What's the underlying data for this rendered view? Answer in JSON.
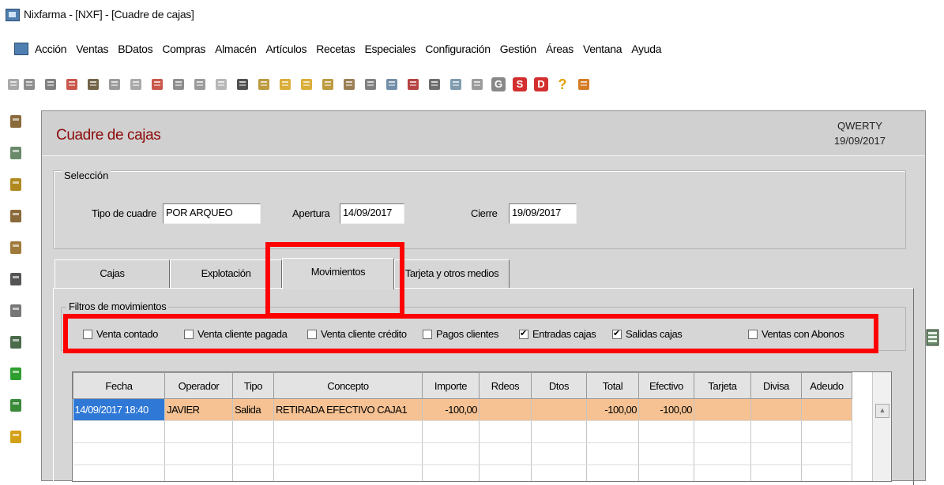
{
  "window": {
    "title": "Nixfarma - [NXF] - [Cuadre de cajas]"
  },
  "menu": [
    "Acción",
    "Ventas",
    "BDatos",
    "Compras",
    "Almacén",
    "Artículos",
    "Recetas",
    "Especiales",
    "Configuración",
    "Gestión",
    "Áreas",
    "Ventana",
    "Ayuda"
  ],
  "toolbar_icons": [
    {
      "name": "grip-icon",
      "color": "#9a9a9a"
    },
    {
      "name": "document-list-icon",
      "color": "#7a7a7a"
    },
    {
      "name": "edit-document-icon",
      "color": "#6a6a6a"
    },
    {
      "name": "stop-icon",
      "color": "#c0392b"
    },
    {
      "name": "print-report-icon",
      "color": "#5a4a2a"
    },
    {
      "name": "notes-icon",
      "color": "#8a8a8a"
    },
    {
      "name": "table-icon",
      "color": "#9a9a9a"
    },
    {
      "name": "pill-bottle-icon",
      "color": "#c0392b"
    },
    {
      "name": "list-icon",
      "color": "#7a7a7a"
    },
    {
      "name": "calculator-icon",
      "color": "#8a8a8a"
    },
    {
      "name": "star-outline-icon",
      "color": "#aaaaaa"
    },
    {
      "name": "star-icon",
      "color": "#333333"
    },
    {
      "name": "exit-icon",
      "color": "#b08a20"
    },
    {
      "name": "arrow-left-icon",
      "color": "#d4a017"
    },
    {
      "name": "arrow-right-icon",
      "color": "#d4a017"
    },
    {
      "name": "import-icon",
      "color": "#b08a20"
    },
    {
      "name": "printer-icon",
      "color": "#8a6a3a"
    },
    {
      "name": "search-icon",
      "color": "#6a6a6a"
    },
    {
      "name": "person-icon",
      "color": "#5a7a9a"
    },
    {
      "name": "lock-icon",
      "color": "#aa2222"
    },
    {
      "name": "block-icon",
      "color": "#555555"
    },
    {
      "name": "monitor-icon",
      "color": "#6a8aa0"
    },
    {
      "name": "filter-icon",
      "color": "#8a8a8a"
    },
    {
      "name": "g-icon",
      "color": "#888888",
      "text": "G"
    },
    {
      "name": "s-icon",
      "color": "#d32f2f",
      "text": "S"
    },
    {
      "name": "d-icon",
      "color": "#d32f2f",
      "text": "D"
    },
    {
      "name": "help-icon",
      "color": "#e0a000",
      "text": "?"
    },
    {
      "name": "home-icon",
      "color": "#cc6600"
    }
  ],
  "left_icons": [
    {
      "name": "cash-register-icon",
      "color": "#8a6a3a"
    },
    {
      "name": "euro-icon",
      "color": "#6a8a6a"
    },
    {
      "name": "customer-icon",
      "color": "#b08a20"
    },
    {
      "name": "cart-icon",
      "color": "#8a6a3a"
    },
    {
      "name": "card-icon",
      "color": "#a07a3a"
    },
    {
      "name": "pen-icon",
      "color": "#555555"
    },
    {
      "name": "money-icon",
      "color": "#777777"
    },
    {
      "name": "form-icon",
      "color": "#4a6a4a"
    },
    {
      "name": "plus-icon",
      "color": "#2e9e2e"
    },
    {
      "name": "refresh-icon",
      "color": "#3a8a3a"
    },
    {
      "name": "warning-icon",
      "color": "#d4a017"
    }
  ],
  "header": {
    "title": "Cuadre de cajas",
    "user": "QWERTY",
    "date": "19/09/2017"
  },
  "seleccion": {
    "label": "Selección",
    "tipo_label": "Tipo de cuadre",
    "tipo_value": "POR ARQUEO",
    "apertura_label": "Apertura",
    "apertura_value": "14/09/2017",
    "cierre_label": "Cierre",
    "cierre_value": "19/09/2017"
  },
  "tabs": [
    "Cajas",
    "Explotación",
    "Movimientos",
    "Tarjeta y otros medios"
  ],
  "active_tab": "Movimientos",
  "filtros": {
    "label": "Filtros de movimientos",
    "items": [
      {
        "label": "Venta contado",
        "checked": false
      },
      {
        "label": "Venta cliente pagada",
        "checked": false
      },
      {
        "label": "Venta cliente crédito",
        "checked": false
      },
      {
        "label": "Pagos clientes",
        "checked": false
      },
      {
        "label": "Entradas cajas",
        "checked": true
      },
      {
        "label": "Salidas cajas",
        "checked": true
      },
      {
        "label": "Ventas con Abonos",
        "checked": false
      }
    ]
  },
  "grid": {
    "columns": [
      "Fecha",
      "Operador",
      "Tipo",
      "Concepto",
      "Importe",
      "Rdeos",
      "Dtos",
      "Total",
      "Efectivo",
      "Tarjeta",
      "Divisa",
      "Adeudo"
    ],
    "rows": [
      [
        "14/09/2017 18:40",
        "JAVIER",
        "Salida",
        "RETIRADA EFECTIVO CAJA1",
        "-100,00",
        "",
        "",
        "-100,00",
        "-100,00",
        "",
        "",
        ""
      ]
    ]
  },
  "colors": {
    "title_red": "#8c0a0a",
    "highlight": "#ff0000",
    "selected_row": "#f6c293",
    "selected_cell": "#2f78d6"
  }
}
